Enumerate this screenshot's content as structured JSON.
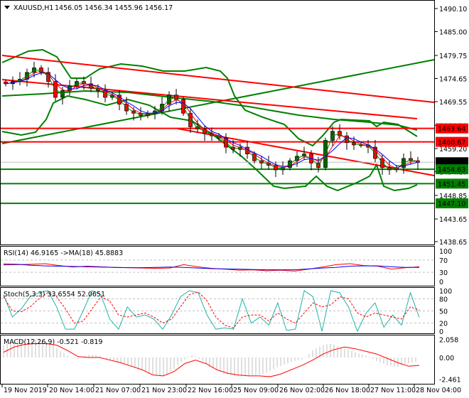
{
  "header": {
    "symbol": "XAUUSD,H1",
    "ohlc": "1456.05 1456.34 1455.96 1456.17"
  },
  "colors": {
    "bull": "#006400",
    "bear": "#ff0000",
    "level_red": "#ff0000",
    "level_green": "#008000",
    "bb": "#008000",
    "current": "#000000"
  },
  "chart_data": [
    {
      "type": "candlestick",
      "title": "XAUUSD,H1",
      "price_axis": [
        "1490.10",
        "1485.00",
        "1479.75",
        "1474.65",
        "1469.55",
        "1464.30",
        "1459.20",
        "1454.10",
        "1448.85",
        "1443.65",
        "1438.65"
      ],
      "ylim": [
        1438.65,
        1490.1
      ],
      "closes": [
        1473.5,
        1474,
        1474.5,
        1476,
        1477,
        1476,
        1474,
        1470.5,
        1472,
        1473,
        1474,
        1473.5,
        1472.5,
        1472,
        1470.5,
        1471,
        1469,
        1467.5,
        1467,
        1466.5,
        1467,
        1467.5,
        1469,
        1471,
        1470,
        1467,
        1464,
        1463.5,
        1462.5,
        1462,
        1461.5,
        1459.5,
        1459,
        1459.5,
        1458,
        1456.5,
        1456,
        1455.5,
        1454.5,
        1455,
        1456.5,
        1457.5,
        1458,
        1456,
        1455,
        1461,
        1463,
        1462,
        1460.5,
        1460,
        1460,
        1459.5,
        1457,
        1455,
        1454.5,
        1455,
        1457,
        1456.5,
        1456.17
      ],
      "current_price": "1456.17",
      "levels_red": [
        "1463.64",
        "1460.67"
      ],
      "levels_green": [
        "1454.63",
        "1451.45",
        "1447.10"
      ],
      "x_labels": [
        "19 Nov 2019",
        "20 Nov 14:00",
        "21 Nov 07:00",
        "21 Nov 23:00",
        "22 Nov 16:00",
        "25 Nov 09:00",
        "26 Nov 02:00",
        "26 Nov 18:00",
        "27 Nov 11:00",
        "28 Nov 04:00"
      ]
    },
    {
      "type": "line",
      "title": "RSI(14) 46.9165  ->MA(18) 45.8883",
      "ticks": [
        "100",
        "70",
        "30",
        "0"
      ],
      "ylim": [
        0,
        100
      ],
      "series": [
        {
          "name": "RSI(14)",
          "values": [
            54,
            55,
            56,
            58,
            52,
            47,
            50,
            48,
            46,
            45,
            44,
            43,
            44,
            55,
            48,
            43,
            40,
            37,
            38,
            35,
            37,
            34,
            40,
            47,
            55,
            58,
            52,
            50,
            40,
            45,
            48
          ]
        },
        {
          "name": "MA(18)",
          "values": [
            57,
            56,
            53,
            51,
            50,
            49,
            48,
            47,
            46,
            45,
            45,
            46,
            47,
            46,
            44,
            42,
            41,
            40,
            39,
            38,
            38,
            38,
            41,
            44,
            46,
            50,
            51,
            51,
            48,
            46,
            46
          ]
        }
      ]
    },
    {
      "type": "line",
      "title": "Stoch(5,3,3) 33.6554 52.0651",
      "ticks": [
        "100",
        "80",
        "50",
        "20",
        "0"
      ],
      "ylim": [
        0,
        100
      ],
      "series": [
        {
          "name": "%K",
          "values": [
            90,
            35,
            55,
            85,
            95,
            100,
            60,
            5,
            5,
            50,
            100,
            90,
            30,
            5,
            60,
            35,
            40,
            30,
            5,
            40,
            85,
            100,
            95,
            40,
            5,
            8,
            5,
            80,
            20,
            35,
            15,
            70,
            2,
            5,
            100,
            85,
            0,
            100,
            95,
            60,
            0,
            45,
            70,
            10,
            40,
            15,
            95,
            34
          ]
        },
        {
          "name": "%D",
          "values": [
            85,
            50,
            48,
            60,
            80,
            95,
            85,
            55,
            20,
            25,
            55,
            85,
            75,
            40,
            35,
            40,
            45,
            35,
            20,
            30,
            60,
            90,
            97,
            75,
            35,
            15,
            8,
            35,
            40,
            40,
            25,
            45,
            30,
            20,
            45,
            70,
            60,
            65,
            85,
            80,
            45,
            35,
            45,
            40,
            35,
            30,
            60,
            52
          ]
        }
      ]
    },
    {
      "type": "bar",
      "title": "MACD(12,26,9) -0.521 -0.819",
      "ticks": [
        "2.058",
        "0.00",
        "-2.461"
      ],
      "ylim": [
        -2.461,
        2.058
      ],
      "histogram": [
        1.4,
        1.8,
        2.0,
        2.1,
        2.0,
        1.6,
        0.8,
        0.1,
        -0.2,
        0.3,
        0.3,
        -0.2,
        -0.5,
        -0.8,
        -1.2,
        -1.6,
        -2.0,
        -2.2,
        -1.5,
        -0.5,
        0.3,
        -0.2,
        -1.0,
        -1.6,
        -2.0,
        -2.2,
        -2.1,
        -2.0,
        -1.8,
        -1.2,
        -0.8,
        -0.4,
        -0.2,
        0.8,
        1.4,
        1.6,
        1.2,
        0.8,
        0.4,
        0.1,
        -0.5,
        -0.9,
        -1.1,
        -0.7,
        -0.5
      ],
      "signal": [
        0.6,
        1.2,
        1.5,
        1.6,
        1.6,
        1.4,
        0.8,
        0.1,
        0.0,
        0.0,
        -0.3,
        -0.6,
        -1.0,
        -1.4,
        -2.0,
        -2.1,
        -1.6,
        -0.7,
        -0.3,
        -0.7,
        -1.4,
        -1.8,
        -2.0,
        -2.1,
        -2.1,
        -2.2,
        -1.9,
        -1.4,
        -0.9,
        -0.3,
        0.4,
        0.9,
        1.2,
        1.0,
        0.7,
        0.4,
        -0.1,
        -0.6,
        -1.0,
        -0.9
      ]
    }
  ]
}
